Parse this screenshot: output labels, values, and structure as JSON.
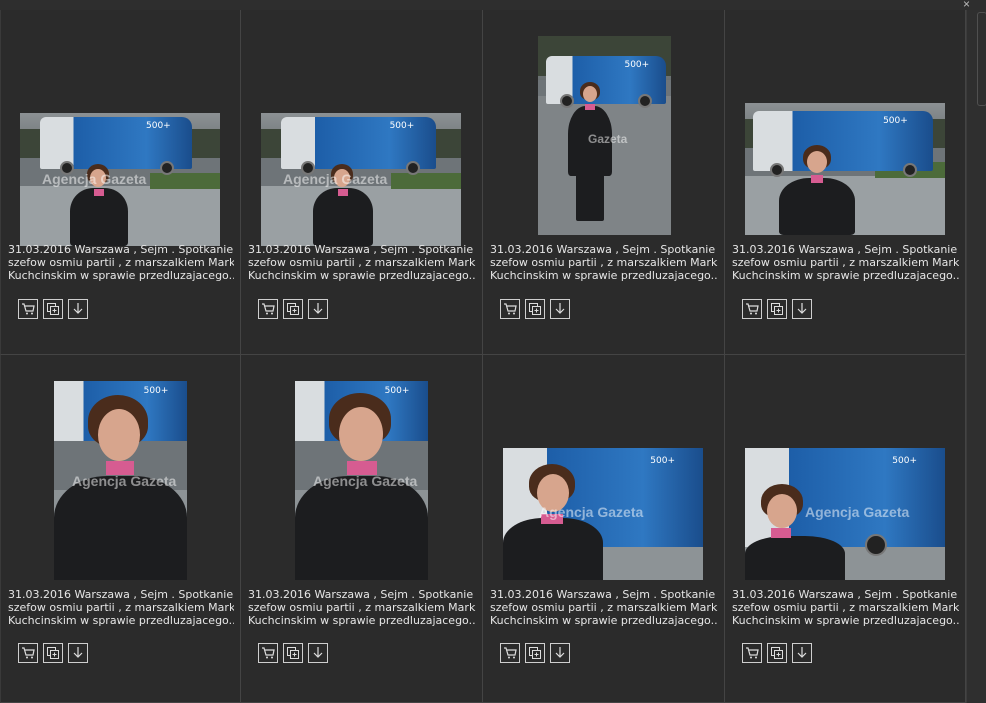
{
  "window": {
    "close_glyph": "×"
  },
  "photos": [
    {
      "caption_lines": [
        "31.03.2016 Warszawa , Sejm . Spotkanie",
        "szefow osmiu partii , z marszalkiem Markiem",
        "Kuchcinskim w sprawie przedluzajacego..."
      ],
      "watermark": "Agencja Gazeta",
      "actions": [
        "cart-icon",
        "lightbox-add-icon",
        "download-icon"
      ]
    },
    {
      "caption_lines": [
        "31.03.2016 Warszawa , Sejm . Spotkanie",
        "szefow osmiu partii , z marszalkiem Markiem",
        "Kuchcinskim w sprawie przedluzajacego..."
      ],
      "watermark": "Agencja Gazeta",
      "actions": [
        "cart-icon",
        "lightbox-add-icon",
        "download-icon"
      ]
    },
    {
      "caption_lines": [
        "31.03.2016 Warszawa , Sejm . Spotkanie",
        "szefow osmiu partii , z marszalkiem Markiem",
        "Kuchcinskim w sprawie przedluzajacego..."
      ],
      "watermark": "Gazeta",
      "actions": [
        "cart-icon",
        "lightbox-add-icon",
        "download-icon"
      ]
    },
    {
      "caption_lines": [
        "31.03.2016 Warszawa , Sejm . Spotkanie",
        "szefow osmiu partii , z marszalkiem Markiem",
        "Kuchcinskim w sprawie przedluzajacego..."
      ],
      "watermark": "",
      "actions": [
        "cart-icon",
        "lightbox-add-icon",
        "download-icon"
      ]
    },
    {
      "caption_lines": [
        "31.03.2016 Warszawa , Sejm . Spotkanie",
        "szefow osmiu partii , z marszalkiem Markiem",
        "Kuchcinskim w sprawie przedluzajacego..."
      ],
      "watermark": "Agencja Gazeta",
      "actions": [
        "cart-icon",
        "lightbox-add-icon",
        "download-icon"
      ]
    },
    {
      "caption_lines": [
        "31.03.2016 Warszawa , Sejm . Spotkanie",
        "szefow osmiu partii , z marszalkiem Markiem",
        "Kuchcinskim w sprawie przedluzajacego..."
      ],
      "watermark": "Agencja Gazeta",
      "actions": [
        "cart-icon",
        "lightbox-add-icon",
        "download-icon"
      ]
    },
    {
      "caption_lines": [
        "31.03.2016 Warszawa , Sejm . Spotkanie",
        "szefow osmiu partii , z marszalkiem Markiem",
        "Kuchcinskim w sprawie przedluzajacego..."
      ],
      "watermark": "Agencja Gazeta",
      "actions": [
        "cart-icon",
        "lightbox-add-icon",
        "download-icon"
      ]
    },
    {
      "caption_lines": [
        "31.03.2016 Warszawa , Sejm . Spotkanie",
        "szefow osmiu partii , z marszalkiem Markiem",
        "Kuchcinskim w sprawie przedluzajacego..."
      ],
      "watermark": "Agencja Gazeta",
      "actions": [
        "cart-icon",
        "lightbox-add-icon",
        "download-icon"
      ]
    }
  ],
  "colors": {
    "background": "#2b2b2b",
    "border": "#444444",
    "text": "#e6e6e6",
    "van_blue": "#1d5ea8",
    "scarf_pink": "#d65c91"
  }
}
